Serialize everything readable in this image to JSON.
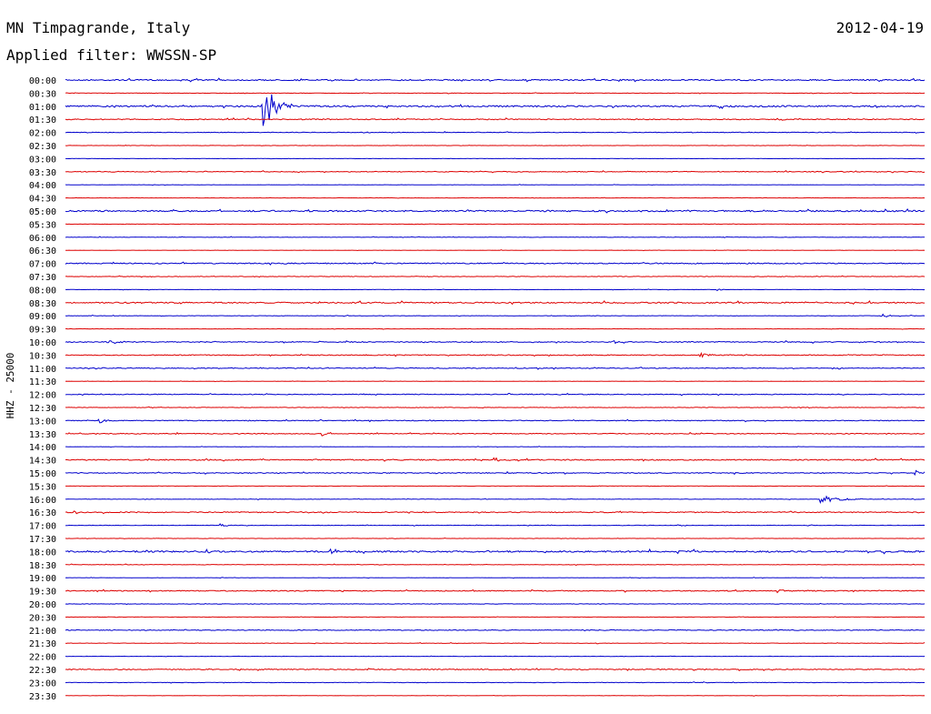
{
  "header": {
    "station": "MN Timpagrande, Italy",
    "date": "2012-04-19",
    "filter_label": "Applied filter: WWSSN-SP"
  },
  "colors": {
    "even_row": "#0000cc",
    "odd_row": "#dd0000",
    "text": "#000000",
    "background": "#ffffff"
  },
  "chart_data": {
    "type": "line",
    "title": "MN Timpagrande, Italy",
    "date": "2012-04-19",
    "subtitle": "Applied filter: WWSSN-SP",
    "ylabel": "HHZ - 25000",
    "xlabel": "",
    "row_interval_minutes": 30,
    "tick_labels": [
      "00:00",
      "00:30",
      "01:00",
      "01:30",
      "02:00",
      "02:30",
      "03:00",
      "03:30",
      "04:00",
      "04:30",
      "05:00",
      "05:30",
      "06:00",
      "06:30",
      "07:00",
      "07:30",
      "08:00",
      "08:30",
      "09:00",
      "09:30",
      "10:00",
      "10:30",
      "11:00",
      "11:30",
      "12:00",
      "12:30",
      "13:00",
      "13:30",
      "14:00",
      "14:30",
      "15:00",
      "15:30",
      "16:00",
      "16:30",
      "17:00",
      "17:30",
      "18:00",
      "18:30",
      "19:00",
      "19:30",
      "20:00",
      "20:30",
      "21:00",
      "21:30",
      "22:00",
      "22:30",
      "23:00",
      "23:30"
    ],
    "series_noise_level": [
      0.8,
      0.3,
      1.0,
      0.6,
      0.4,
      0.2,
      0.2,
      0.5,
      0.2,
      0.2,
      0.9,
      0.2,
      0.3,
      0.2,
      0.7,
      0.3,
      0.2,
      0.8,
      0.3,
      0.2,
      0.6,
      0.6,
      0.5,
      0.2,
      0.5,
      0.3,
      0.5,
      0.5,
      0.2,
      0.7,
      0.6,
      0.2,
      0.3,
      0.6,
      0.3,
      0.2,
      1.0,
      0.3,
      0.2,
      0.6,
      0.3,
      0.2,
      0.5,
      0.3,
      0.2,
      0.6,
      0.3,
      0.2
    ],
    "events": [
      {
        "row": 2,
        "position": 0.23,
        "amplitude": 28,
        "duration": 0.04
      },
      {
        "row": 3,
        "position": 0.83,
        "amplitude": 2.5,
        "duration": 0.02
      },
      {
        "row": 16,
        "position": 0.76,
        "amplitude": 1.5,
        "duration": 0.01
      },
      {
        "row": 18,
        "position": 0.95,
        "amplitude": 2.5,
        "duration": 0.02
      },
      {
        "row": 20,
        "position": 0.05,
        "amplitude": 2.5,
        "duration": 0.03
      },
      {
        "row": 20,
        "position": 0.64,
        "amplitude": 2.5,
        "duration": 0.01
      },
      {
        "row": 21,
        "position": 0.74,
        "amplitude": 2.5,
        "duration": 0.03
      },
      {
        "row": 26,
        "position": 0.04,
        "amplitude": 2.5,
        "duration": 0.02
      },
      {
        "row": 27,
        "position": 0.3,
        "amplitude": 3.0,
        "duration": 0.01
      },
      {
        "row": 29,
        "position": 0.5,
        "amplitude": 2.5,
        "duration": 0.02
      },
      {
        "row": 30,
        "position": 0.99,
        "amplitude": 3.0,
        "duration": 0.01
      },
      {
        "row": 32,
        "position": 0.88,
        "amplitude": 4.5,
        "duration": 0.05
      },
      {
        "row": 33,
        "position": 0.01,
        "amplitude": 2.0,
        "duration": 0.02
      },
      {
        "row": 34,
        "position": 0.18,
        "amplitude": 2.0,
        "duration": 0.02
      },
      {
        "row": 36,
        "position": 0.31,
        "amplitude": 3.5,
        "duration": 0.02
      },
      {
        "row": 39,
        "position": 0.83,
        "amplitude": 2.0,
        "duration": 0.03
      }
    ]
  }
}
